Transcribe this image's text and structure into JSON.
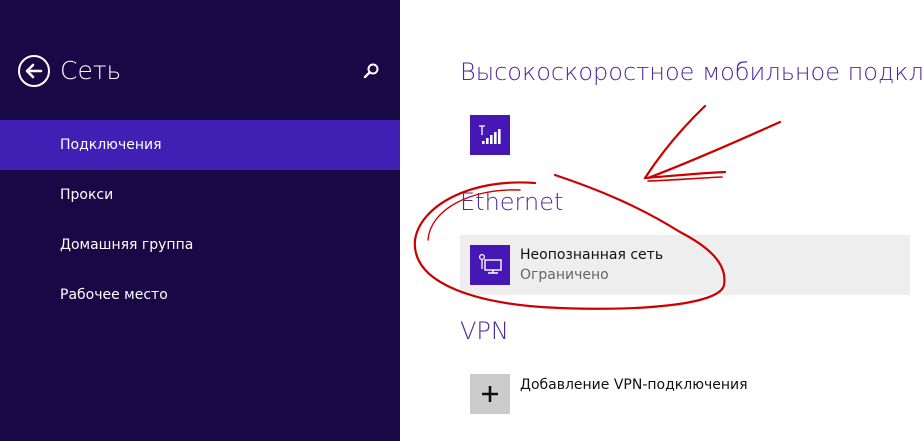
{
  "sidebar": {
    "title": "Сеть",
    "back_icon": "back-arrow-icon",
    "search_icon": "search-icon",
    "items": [
      {
        "label": "Подключения",
        "selected": true
      },
      {
        "label": "Прокси",
        "selected": false
      },
      {
        "label": "Домашняя группа",
        "selected": false
      },
      {
        "label": "Рабочее место",
        "selected": false
      }
    ]
  },
  "main": {
    "mobile": {
      "heading": "Высокоскоростное мобильное подключение",
      "icon": "signal-bars-icon"
    },
    "ethernet": {
      "heading": "Ethernet",
      "icon": "wired-network-icon",
      "network_name": "Неопознанная сеть",
      "network_status": "Ограничено"
    },
    "vpn": {
      "heading": "VPN",
      "icon": "plus-icon",
      "add_label": "Добавление VPN-подключения"
    }
  },
  "colors": {
    "sidebar_bg": "#190846",
    "selected_bg": "#3f1fb4",
    "accent": "#4617b4",
    "heading": "#4a2a9e",
    "annotation": "#cc0000"
  }
}
